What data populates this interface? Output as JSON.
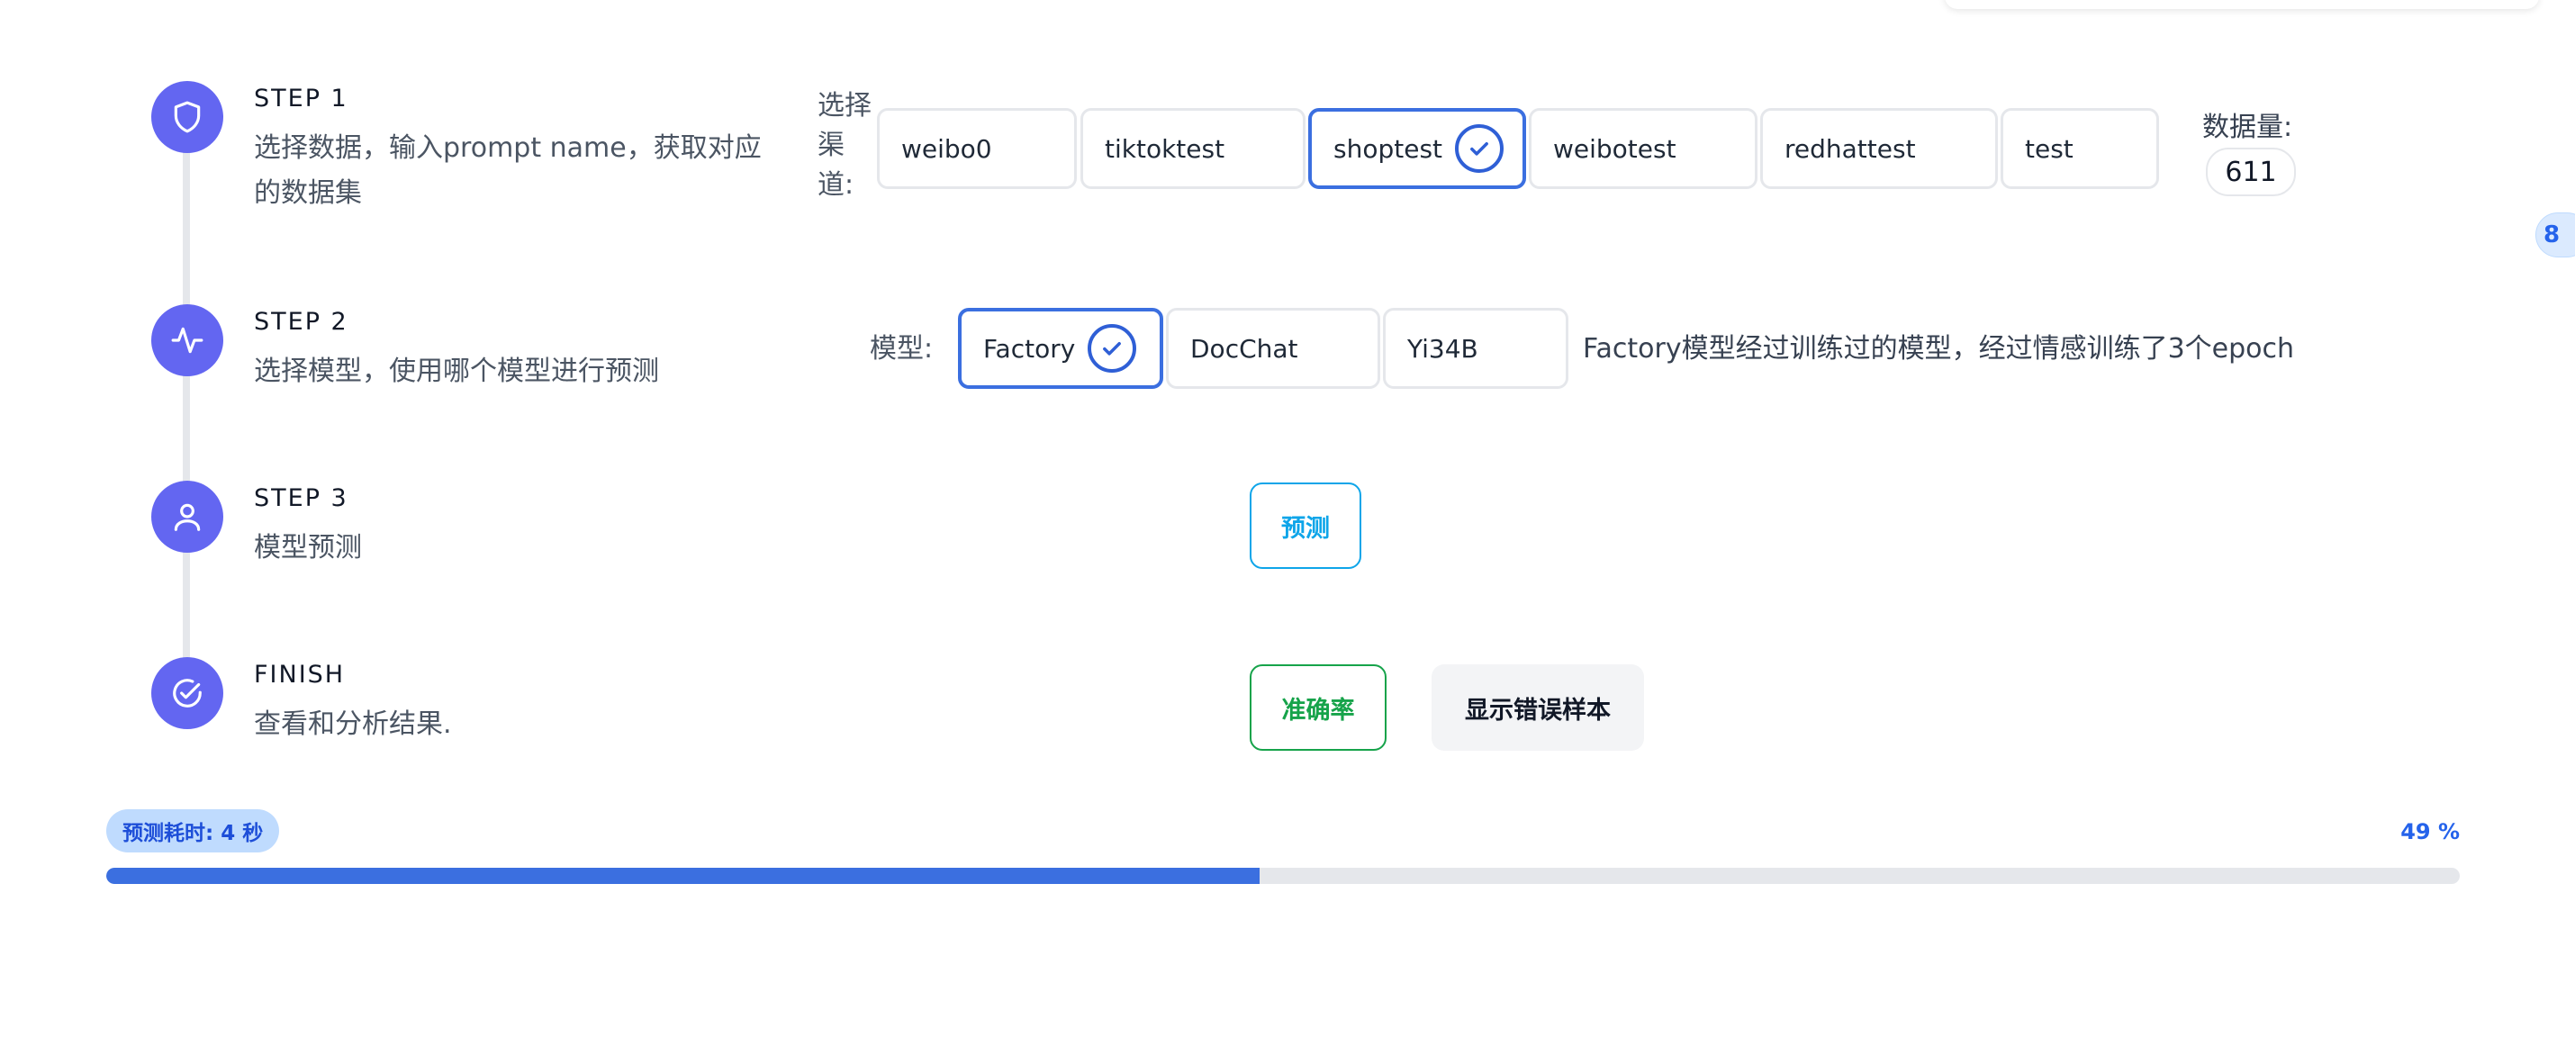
{
  "steps": [
    {
      "title": "STEP 1",
      "desc_line1": "选择数据，输入prompt name，获取对应",
      "desc_line2": "的数据集",
      "icon": "shield-icon"
    },
    {
      "title": "STEP 2",
      "desc_line1": "选择模型，使用哪个模型进行预测",
      "icon": "activity-icon"
    },
    {
      "title": "STEP 3",
      "desc_line1": "模型预测",
      "icon": "user-icon"
    },
    {
      "title": "FINISH",
      "desc_line1": "查看和分析结果.",
      "icon": "check-circle-icon"
    }
  ],
  "channel": {
    "label_line1": "选择",
    "label_line2": "渠",
    "label_line3": "道:",
    "options": [
      "weibo0",
      "tiktoktest",
      "shoptest",
      "weibotest",
      "redhattest",
      "test"
    ],
    "selected": "shoptest",
    "count_label": "数据量:",
    "count_value": "611"
  },
  "model": {
    "label": "模型:",
    "options": [
      "Factory",
      "DocChat",
      "Yi34B"
    ],
    "selected": "Factory",
    "description": "Factory模型经过训练过的模型，经过情感训练了3个epoch"
  },
  "actions": {
    "predict_label": "预测",
    "accuracy_label": "准确率",
    "show_errors_label": "显示错误样本"
  },
  "progress": {
    "time_label": "预测耗时: 4 秒",
    "percent_label": "49 %",
    "fraction": 0.49
  },
  "side_tab": {
    "label": "8"
  },
  "colors": {
    "accent": "#6366f1",
    "primary": "#3b6fe0",
    "predict": "#0ea5e9",
    "accuracy": "#16a34a"
  }
}
